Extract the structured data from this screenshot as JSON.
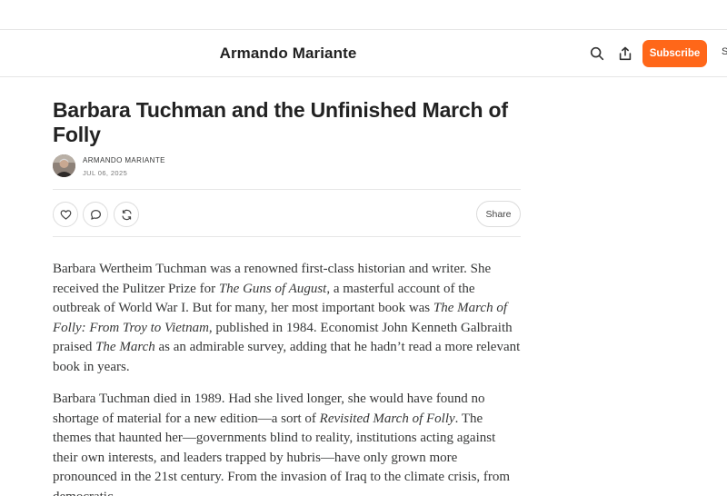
{
  "header": {
    "publication_title": "Armando Mariante",
    "subscribe_label": "Subscribe",
    "signin_partial": "S"
  },
  "post": {
    "title": "Barbara Tuchman and the Unfinished March of Folly",
    "author": "ARMANDO MARIANTE",
    "date": "JUL 06, 2025",
    "share_label": "Share"
  },
  "body": {
    "p1": [
      {
        "t": "Barbara Wertheim Tuchman was a renowned first-class historian and writer. She received the Pulitzer Prize for "
      },
      {
        "t": "The Guns of August",
        "i": true
      },
      {
        "t": ", a masterful account of the outbreak of World War I. But for many, her most important book was "
      },
      {
        "t": "The March of Folly: From Troy to Vietnam",
        "i": true
      },
      {
        "t": ", published in 1984. Economist John Kenneth Galbraith praised "
      },
      {
        "t": "The March",
        "i": true
      },
      {
        "t": " as an admirable survey, adding that he hadn’t read a more relevant book in years."
      }
    ],
    "p2": [
      {
        "t": "Barbara Tuchman died in 1989. Had she lived longer, she would have found no shortage of material for a new edition—a sort of "
      },
      {
        "t": "Revisited March of Folly",
        "i": true
      },
      {
        "t": ". The themes that haunted her—governments blind to reality, institutions acting against their own interests, and leaders trapped by hubris—have only grown more pronounced in the 21st century. From the invasion of Iraq to the climate crisis, from democratic"
      }
    ]
  },
  "icons": {
    "header": [
      "search-icon",
      "share-upload-icon"
    ],
    "actions": [
      "heart-icon",
      "comment-icon",
      "restack-icon"
    ]
  },
  "colors": {
    "accent": "#ff6719",
    "text": "#363737",
    "divider": "#e6e6e6"
  }
}
